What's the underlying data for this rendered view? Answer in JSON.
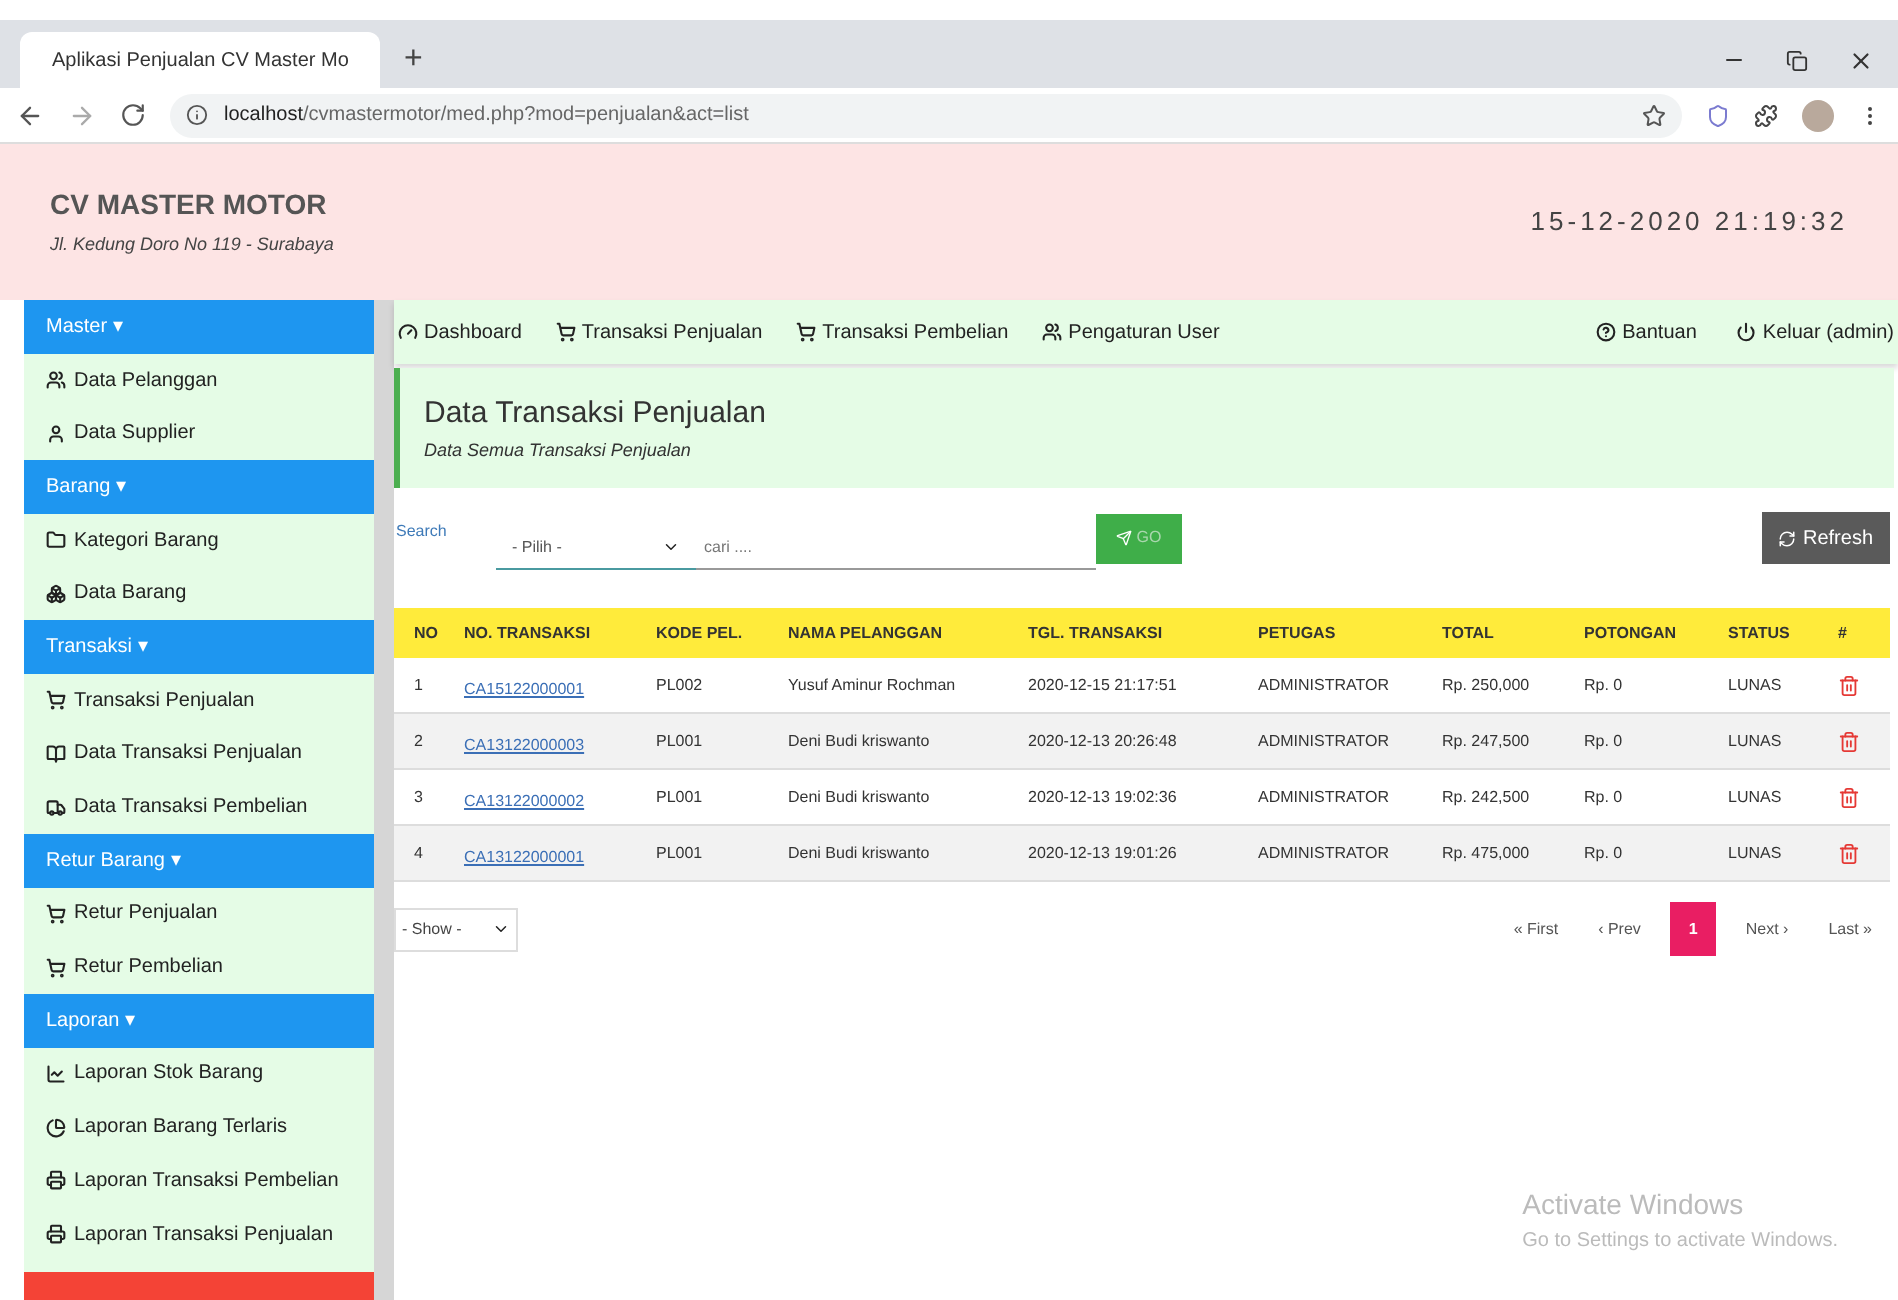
{
  "browser": {
    "tab_title": "Aplikasi Penjualan CV Master Mo",
    "new_tab": "+",
    "url_host": "localhost",
    "url_path": "/cvmastermotor/med.php?mod=penjualan&act=list"
  },
  "header": {
    "title": "CV MASTER MOTOR",
    "address": "Jl. Kedung Doro No 119 - Surabaya",
    "datetime": "15-12-2020 21:19:32"
  },
  "sidebar": {
    "sections": [
      {
        "label": "Master ▾",
        "items": [
          "Data Pelanggan",
          "Data Supplier"
        ]
      },
      {
        "label": "Barang ▾",
        "items": [
          "Kategori Barang",
          "Data Barang"
        ]
      },
      {
        "label": "Transaksi ▾",
        "items": [
          "Transaksi Penjualan",
          "Data Transaksi Penjualan",
          "Data Transaksi Pembelian"
        ]
      },
      {
        "label": "Retur Barang ▾",
        "items": [
          "Retur Penjualan",
          "Retur Pembelian"
        ]
      },
      {
        "label": "Laporan ▾",
        "items": [
          "Laporan Stok Barang",
          "Laporan Barang Terlaris",
          "Laporan Transaksi Pembelian",
          "Laporan Transaksi Penjualan"
        ]
      }
    ]
  },
  "navbar": {
    "left": [
      "Dashboard",
      "Transaksi Penjualan",
      "Transaksi Pembelian",
      "Pengaturan User"
    ],
    "right": [
      "Bantuan",
      "Keluar (admin)"
    ]
  },
  "page_header": {
    "title": "Data Transaksi Penjualan",
    "subtitle": "Data Semua Transaksi Penjualan"
  },
  "search": {
    "label": "Search",
    "select_value": "- Pilih -",
    "placeholder": "cari ....",
    "go_button": "GO",
    "refresh_button": "Refresh"
  },
  "table": {
    "columns": [
      "NO",
      "NO. TRANSAKSI",
      "KODE PEL.",
      "NAMA PELANGGAN",
      "TGL. TRANSAKSI",
      "PETUGAS",
      "TOTAL",
      "POTONGAN",
      "STATUS",
      "#"
    ],
    "rows": [
      [
        "1",
        "CA15122000001",
        "PL002",
        "Yusuf Aminur Rochman",
        "2020-12-15 21:17:51",
        "ADMINISTRATOR",
        "Rp. 250,000",
        "Rp. 0",
        "LUNAS"
      ],
      [
        "2",
        "CA13122000003",
        "PL001",
        "Deni Budi kriswanto",
        "2020-12-13 20:26:48",
        "ADMINISTRATOR",
        "Rp. 247,500",
        "Rp. 0",
        "LUNAS"
      ],
      [
        "3",
        "CA13122000002",
        "PL001",
        "Deni Budi kriswanto",
        "2020-12-13 19:02:36",
        "ADMINISTRATOR",
        "Rp. 242,500",
        "Rp. 0",
        "LUNAS"
      ],
      [
        "4",
        "CA13122000001",
        "PL001",
        "Deni Budi kriswanto",
        "2020-12-13 19:01:26",
        "ADMINISTRATOR",
        "Rp. 475,000",
        "Rp. 0",
        "LUNAS"
      ]
    ]
  },
  "show_select": "- Show -",
  "pagination": [
    {
      "label": "« First",
      "selected": false
    },
    {
      "label": "‹ Prev",
      "selected": false
    },
    {
      "label": "1",
      "selected": true
    },
    {
      "label": "Next ›",
      "selected": false
    },
    {
      "label": "Last »",
      "selected": false
    }
  ],
  "activation_notice": {
    "title": "Activate Windows",
    "text": "Go to Settings to activate Windows."
  }
}
